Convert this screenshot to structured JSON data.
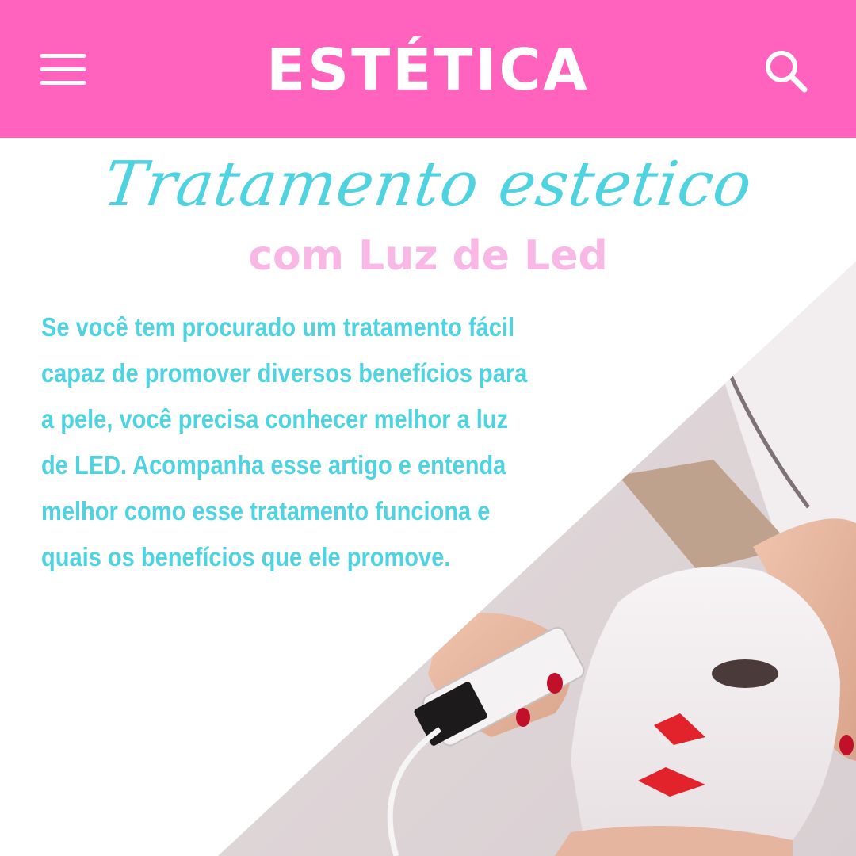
{
  "header": {
    "title": "ESTÉTICA",
    "menu_icon": "hamburger-menu-icon",
    "search_icon": "search-icon"
  },
  "hero": {
    "headline": "Tratamento estetico",
    "subheadline": "com Luz de Led"
  },
  "article": {
    "paragraph": "Se você tem procurado um tratamento fácil capaz de promover diversos benefícios para a pele, você precisa conhecer melhor a luz de LED. Acompanha esse artigo e entenda melhor como esse tratamento funciona e quais os benefícios que ele promove."
  },
  "colors": {
    "header_bg": "#ff63bd",
    "headline": "#4fd3e0",
    "subheadline": "#f8b7e5",
    "body_text": "#4fd3e0"
  }
}
